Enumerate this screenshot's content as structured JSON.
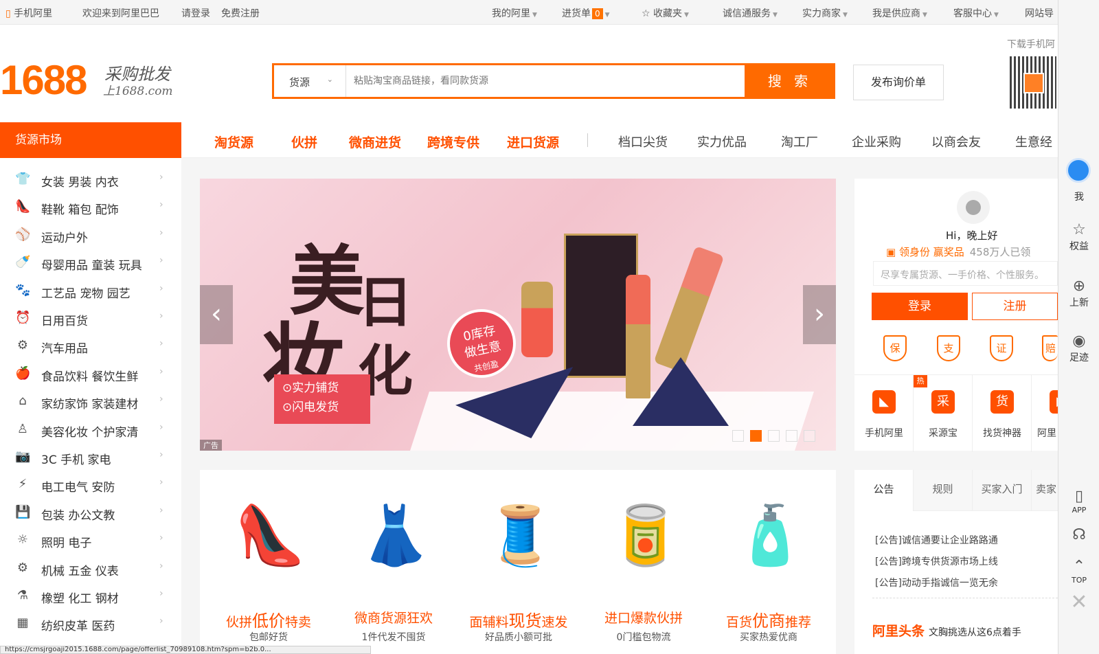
{
  "topbar": {
    "mobile": "手机阿里",
    "welcome": "欢迎来到阿里巴巴",
    "login": "请登录",
    "register": "免费注册",
    "my_ali": "我的阿里",
    "cart": "进货单",
    "cart_count": "0",
    "favorites": "收藏夹",
    "trust": "诚信通服务",
    "strong": "实力商家",
    "supplier": "我是供应商",
    "service": "客服中心",
    "sitenav": "网站导"
  },
  "header": {
    "logo_num": "1688",
    "logo_cn": "采购批发",
    "logo_domain": "上1688.com",
    "search_category": "货源",
    "search_placeholder": "粘贴淘宝商品链接，看同款货源",
    "search_button": "搜 索",
    "rfq_button": "发布询价单",
    "download": "下载手机阿"
  },
  "nav": {
    "market": "货源市场",
    "hot": [
      "淘货源",
      "伙拼",
      "微商进货",
      "跨境专供",
      "进口货源"
    ],
    "normal": [
      "档口尖货",
      "实力优品",
      "淘工厂",
      "企业采购",
      "以商会友",
      "生意经"
    ]
  },
  "categories": [
    {
      "label": "女装 男装 内衣",
      "icon": "shirt-icon",
      "glyph": "👕"
    },
    {
      "label": "鞋靴 箱包 配饰",
      "icon": "shoe-icon",
      "glyph": "👠"
    },
    {
      "label": "运动户外",
      "icon": "ball-icon",
      "glyph": "⚾"
    },
    {
      "label": "母婴用品 童装 玩具",
      "icon": "baby-bottle-icon",
      "glyph": "🍼"
    },
    {
      "label": "工艺品 宠物 园艺",
      "icon": "paw-icon",
      "glyph": "🐾"
    },
    {
      "label": "日用百货",
      "icon": "clock-icon",
      "glyph": "⏰"
    },
    {
      "label": "汽车用品",
      "icon": "wheel-icon",
      "glyph": "⚙"
    },
    {
      "label": "食品饮料 餐饮生鲜",
      "icon": "apple-icon",
      "glyph": "🍎"
    },
    {
      "label": "家纺家饰 家装建材",
      "icon": "house-icon",
      "glyph": "⌂"
    },
    {
      "label": "美容化妆 个护家清",
      "icon": "cosmetic-icon",
      "glyph": "♙"
    },
    {
      "label": "3C 手机 家电",
      "icon": "camera-icon",
      "glyph": "📷"
    },
    {
      "label": "电工电气 安防",
      "icon": "plug-icon",
      "glyph": "⚡"
    },
    {
      "label": "包装 办公文教",
      "icon": "floppy-icon",
      "glyph": "💾"
    },
    {
      "label": "照明 电子",
      "icon": "bulb-icon",
      "glyph": "☼"
    },
    {
      "label": "机械 五金 仪表",
      "icon": "gear-icon",
      "glyph": "⚙"
    },
    {
      "label": "橡塑 化工 钢材",
      "icon": "chemical-icon",
      "glyph": "⚗"
    },
    {
      "label": "纺织皮革 医药",
      "icon": "textile-icon",
      "glyph": "▦"
    }
  ],
  "banner": {
    "char1": "美",
    "char2": "妆",
    "char3": "日化",
    "tag1": "⊙实力铺货",
    "tag2": "⊙闪电发货",
    "circle1": "0库存",
    "circle2": "做生意",
    "circle3": "共创盈",
    "ad_label": "广告",
    "active_slide": 1,
    "slide_count": 5
  },
  "products": [
    {
      "pre": "伙拼",
      "big": "低价",
      "post": "特卖",
      "sub": "包邮好货",
      "icon": "high-heel-icon",
      "glyph": "👠"
    },
    {
      "pre": "微商",
      "big": "",
      "post": "货源狂欢",
      "sub": "1件代发不囤货",
      "icon": "dress-icon",
      "glyph": "👗"
    },
    {
      "pre": "面辅料",
      "big": "现货",
      "post": "速发",
      "sub": "好品质小额可批",
      "icon": "fabric-icon",
      "glyph": "🧵"
    },
    {
      "pre": "进口",
      "big": "",
      "post": "爆款伙拼",
      "sub": "0门槛包物流",
      "icon": "snack-icon",
      "glyph": "🥫"
    },
    {
      "pre": "百货",
      "big": "优商",
      "post": "推荐",
      "sub": "买家热爱优商",
      "icon": "bottle-icon",
      "glyph": "🧴"
    }
  ],
  "user": {
    "greeting": "Hi，晚上好",
    "claim_icon": "▣",
    "claim1": "领身份 赢奖品",
    "claim2": "458万人已领",
    "hint": "尽享专属货源、一手价格、个性服务。",
    "login": "登录",
    "register": "注册",
    "shields": [
      "保",
      "支",
      "证",
      "赔"
    ]
  },
  "apps": [
    {
      "label": "手机阿里",
      "glyph": "◣"
    },
    {
      "label": "采源宝",
      "glyph": "采"
    },
    {
      "label": "找货神器",
      "glyph": "货"
    },
    {
      "label": "阿里",
      "glyph": "▶"
    }
  ],
  "hot_badge": "热",
  "notice": {
    "tabs": [
      "公告",
      "规则",
      "买家入门",
      "卖家"
    ],
    "lines": [
      "[公告]诚信通要让企业路路通",
      "[公告]跨境专供货源市场上线",
      "[公告]动动手指诚信一览无余"
    ],
    "headline_title": "阿里头条",
    "headline_text": "文胸挑选从这6点着手"
  },
  "toolbar": {
    "me": "我",
    "benefits": "权益",
    "new": "上新",
    "footprint": "足迹",
    "app": "APP",
    "top": "TOP"
  },
  "status_url": "https://cmsjrgoaji2015.1688.com/page/offerlist_70989108.htm?spm=b2b.0..."
}
